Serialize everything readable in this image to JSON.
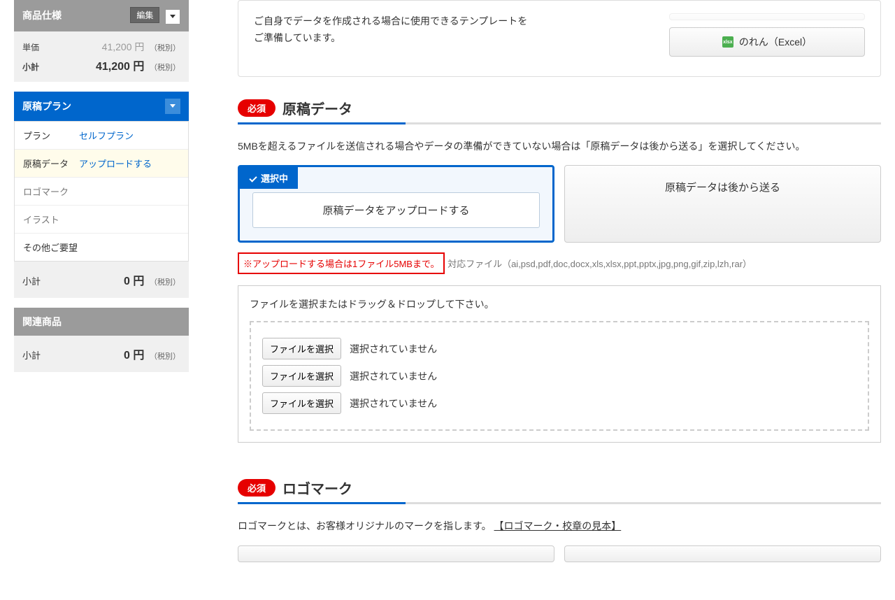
{
  "sidebar": {
    "spec": {
      "title": "商品仕様",
      "edit": "編集",
      "unit_label": "単価",
      "unit_value": "41,200 円",
      "unit_suffix": "（税別）",
      "subtotal_label": "小計",
      "subtotal_value": "41,200 円",
      "subtotal_suffix": "（税別）"
    },
    "plan": {
      "title": "原稿プラン",
      "rows": [
        {
          "k": "プラン",
          "v": "セルフプラン"
        },
        {
          "k": "原稿データ",
          "v": "アップロードする"
        },
        {
          "k": "ロゴマーク",
          "v": ""
        },
        {
          "k": "イラスト",
          "v": ""
        },
        {
          "k": "その他ご要望",
          "v": ""
        }
      ],
      "subtotal_label": "小計",
      "subtotal_value": "0 円",
      "subtotal_suffix": "（税別）"
    },
    "related": {
      "title": "関連商品",
      "subtotal_label": "小計",
      "subtotal_value": "0 円",
      "subtotal_suffix": "（税別）"
    }
  },
  "main": {
    "template": {
      "text1": "ご自身でデータを作成される場合に使用できるテンプレートを",
      "text2": "ご準備しています。",
      "btn_excel": "のれん（Excel）",
      "xls_badge": "xlsx"
    },
    "manuscript": {
      "badge": "必須",
      "title": "原稿データ",
      "desc": "5MBを超えるファイルを送信される場合やデータの準備ができていない場合は「原稿データは後から送る」を選択してください。",
      "selected_label": "選択中",
      "choice_upload": "原稿データをアップロードする",
      "choice_later": "原稿データは後から送る",
      "note_red": "※アップロードする場合は1ファイル5MBまで。",
      "note_gray": "対応ファイル（ai,psd,pdf,doc,docx,xls,xlsx,ppt,pptx,jpg,png,gif,zip,lzh,rar）",
      "dz_title": "ファイルを選択またはドラッグ＆ドロップして下さい。",
      "file_pick": "ファイルを選択",
      "file_none": "選択されていません"
    },
    "logo": {
      "badge": "必須",
      "title": "ロゴマーク",
      "desc_pre": "ロゴマークとは、お客様オリジナルのマークを指します。",
      "desc_link": "【ロゴマーク・校章の見本】"
    }
  }
}
